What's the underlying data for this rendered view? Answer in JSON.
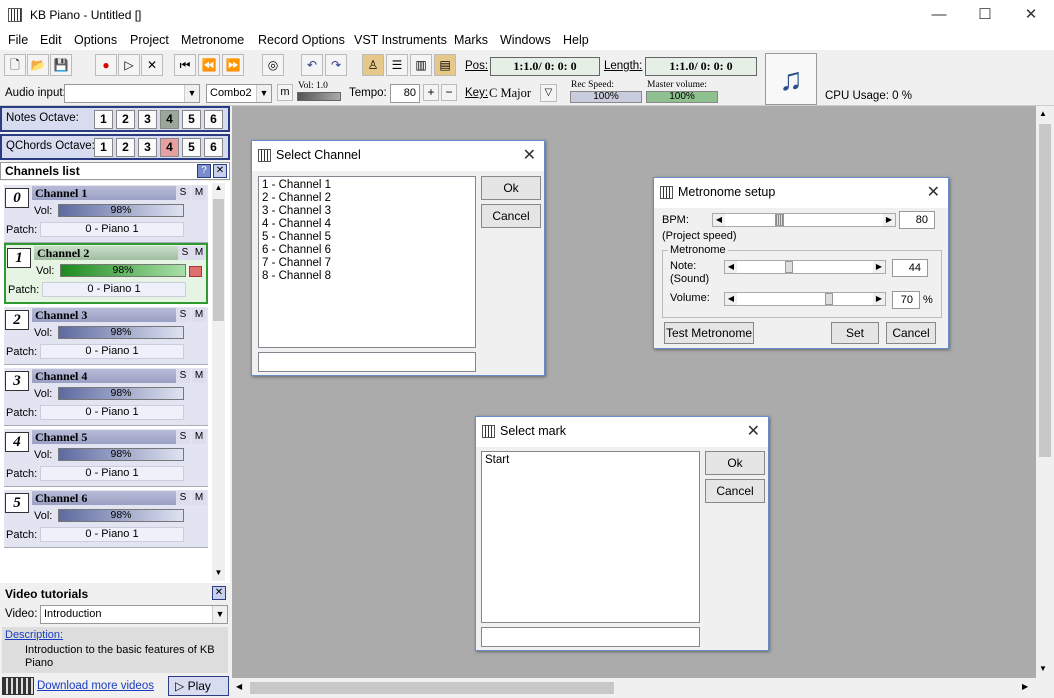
{
  "window": {
    "title": "KB Piano - Untitled []",
    "minimize": "—",
    "maximize": "☐",
    "close": "✕"
  },
  "menu": [
    "File",
    "Edit",
    "Options",
    "Project",
    "Metronome",
    "Record Options",
    "VST Instruments",
    "Marks",
    "Windows",
    "Help"
  ],
  "toolbar": {
    "audio_input_label": "Audio input:",
    "audio_input_value": "",
    "combo": "Combo2",
    "m": "m",
    "vol_label": "Vol: 1.0",
    "tempo_label": "Tempo:",
    "tempo_value": "80",
    "plus": "+",
    "minus": "−",
    "key_label": "Key:",
    "key_value": "C Major",
    "pos_label": "Pos:",
    "pos_value": "1:1.0/ 0: 0: 0",
    "length_label": "Length:",
    "length_value": "1:1.0/ 0: 0: 0",
    "rec_speed_label": "Rec Speed:",
    "rec_speed_value": "100%",
    "master_volume_label": "Master volume:",
    "master_volume_value": "100%",
    "cpu": "CPU Usage: 0 %"
  },
  "notes_octave": {
    "label": "Notes Octave:",
    "buttons": [
      "1",
      "2",
      "3",
      "4",
      "5",
      "6"
    ]
  },
  "qchords_octave": {
    "label": "QChords Octave:",
    "buttons": [
      "1",
      "2",
      "3",
      "4",
      "5",
      "6"
    ]
  },
  "channels_list": {
    "title": "Channels list",
    "help": "?",
    "close": "✕",
    "vol_label": "Vol:",
    "patch_label": "Patch:",
    "s": "S",
    "m": "M",
    "items": [
      {
        "num": "0",
        "name": "Channel 1",
        "vol": "98%",
        "patch": "0 - Piano 1"
      },
      {
        "num": "1",
        "name": "Channel 2",
        "vol": "98%",
        "patch": "0 - Piano 1"
      },
      {
        "num": "2",
        "name": "Channel 3",
        "vol": "98%",
        "patch": "0 - Piano 1"
      },
      {
        "num": "3",
        "name": "Channel 4",
        "vol": "98%",
        "patch": "0 - Piano 1"
      },
      {
        "num": "4",
        "name": "Channel 5",
        "vol": "98%",
        "patch": "0 - Piano 1"
      },
      {
        "num": "5",
        "name": "Channel 6",
        "vol": "98%",
        "patch": "0 - Piano 1"
      }
    ]
  },
  "video": {
    "title": "Video tutorials",
    "close": "✕",
    "label": "Video:",
    "value": "Introduction",
    "desc_link": "Description:",
    "desc": "Introduction to the basic features of KB Piano",
    "download": "Download more videos",
    "play": "Play"
  },
  "select_channel": {
    "title": "Select Channel",
    "ok": "Ok",
    "cancel": "Cancel",
    "items": [
      "1 - Channel 1",
      "2 - Channel 2",
      "3 - Channel 3",
      "4 - Channel 4",
      "5 - Channel 5",
      "6 - Channel 6",
      "7 - Channel 7",
      "8 - Channel 8"
    ]
  },
  "select_mark": {
    "title": "Select mark",
    "ok": "Ok",
    "cancel": "Cancel",
    "items": [
      "Start"
    ]
  },
  "metronome": {
    "title": "Metronome setup",
    "bpm_label": "BPM:",
    "bpm_value": "80",
    "project_speed": "(Project speed)",
    "group": "Metronome",
    "note_label": "Note:",
    "sound_label": "(Sound)",
    "note_value": "44",
    "volume_label": "Volume:",
    "volume_value": "70",
    "pct": "%",
    "test": "Test Metronome",
    "set": "Set",
    "cancel": "Cancel"
  }
}
